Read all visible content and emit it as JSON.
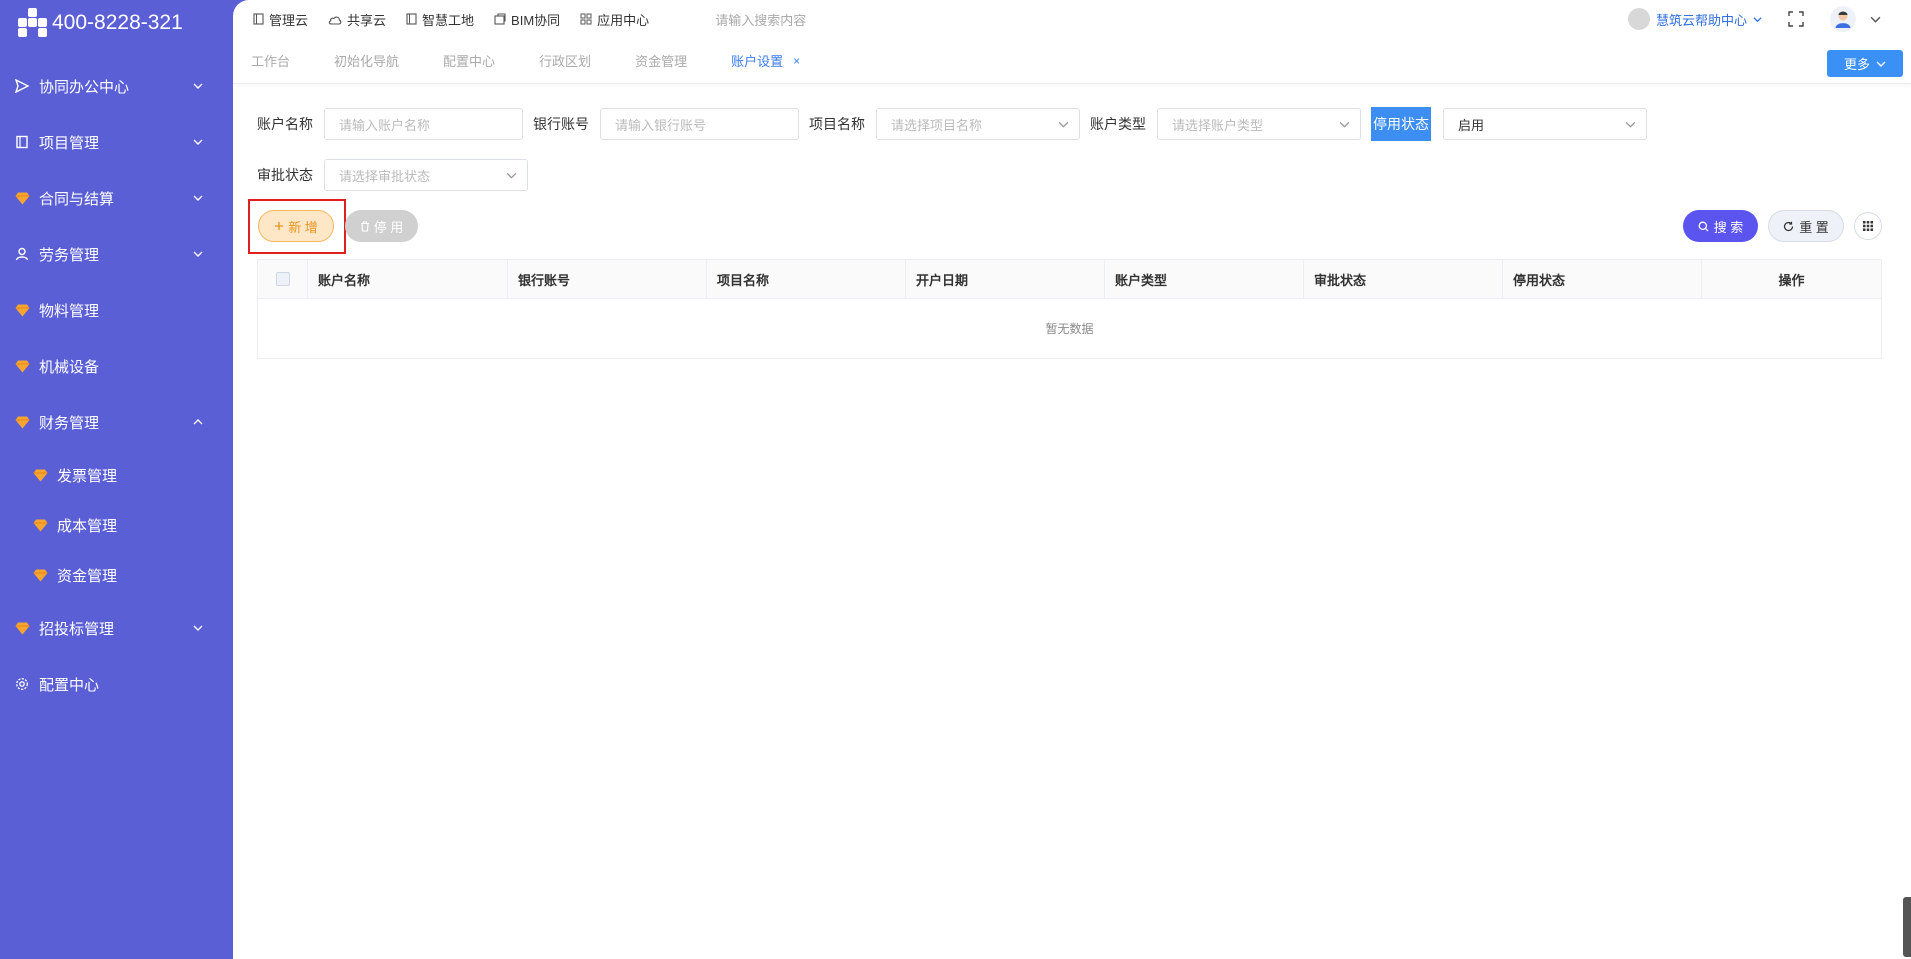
{
  "sidebar": {
    "phone": "400-8228-321",
    "menu": [
      {
        "label": "协同办公中心",
        "icon": "send-icon",
        "chevron": "down"
      },
      {
        "label": "项目管理",
        "icon": "book-icon",
        "chevron": "down"
      },
      {
        "label": "合同与结算",
        "icon": "gem-icon",
        "chevron": "down"
      },
      {
        "label": "劳务管理",
        "icon": "user-icon",
        "chevron": "down"
      },
      {
        "label": "物料管理",
        "icon": "gem-icon"
      },
      {
        "label": "机械设备",
        "icon": "gem-icon"
      },
      {
        "label": "财务管理",
        "icon": "gem-icon",
        "chevron": "up"
      }
    ],
    "submenu": [
      {
        "label": "发票管理",
        "icon": "gem-icon"
      },
      {
        "label": "成本管理",
        "icon": "gem-icon"
      },
      {
        "label": "资金管理",
        "icon": "gem-icon"
      }
    ],
    "menu_after": [
      {
        "label": "招投标管理",
        "icon": "gem-icon",
        "chevron": "down"
      },
      {
        "label": "配置中心",
        "icon": "gear-icon"
      }
    ]
  },
  "topbar": {
    "nav": [
      "管理云",
      "共享云",
      "智慧工地",
      "BIM协同",
      "应用中心"
    ],
    "search_placeholder": "请输入搜索内容",
    "help_label": "慧筑云帮助中心"
  },
  "tabs": {
    "items": [
      "工作台",
      "初始化导航",
      "配置中心",
      "行政区划",
      "资金管理",
      "账户设置"
    ],
    "active": "账户设置",
    "close": "×",
    "more_label": "更多"
  },
  "filters": {
    "account_name_label": "账户名称",
    "account_name_placeholder": "请输入账户名称",
    "bank_account_label": "银行账号",
    "bank_account_placeholder": "请输入银行账号",
    "project_name_label": "项目名称",
    "project_name_placeholder": "请选择项目名称",
    "account_type_label": "账户类型",
    "account_type_placeholder": "请选择账户类型",
    "disable_status_label": "停用状态",
    "disable_status_value": "启用",
    "approval_status_label": "审批状态",
    "approval_status_placeholder": "请选择审批状态"
  },
  "actions": {
    "new_label": "新 增",
    "stop_label": "停 用",
    "search_label": "搜 索",
    "reset_label": "重 置"
  },
  "table": {
    "columns": [
      "账户名称",
      "银行账号",
      "项目名称",
      "开户日期",
      "账户类型",
      "审批状态",
      "停用状态",
      "操作"
    ],
    "empty_text": "暂无数据"
  },
  "colors": {
    "sidebar_bg": "#5b5fd6",
    "accent_blue": "#3b7cf5",
    "search_button": "#5b54ee",
    "new_button": "#fde7c6",
    "highlight_box": "#e02020"
  }
}
